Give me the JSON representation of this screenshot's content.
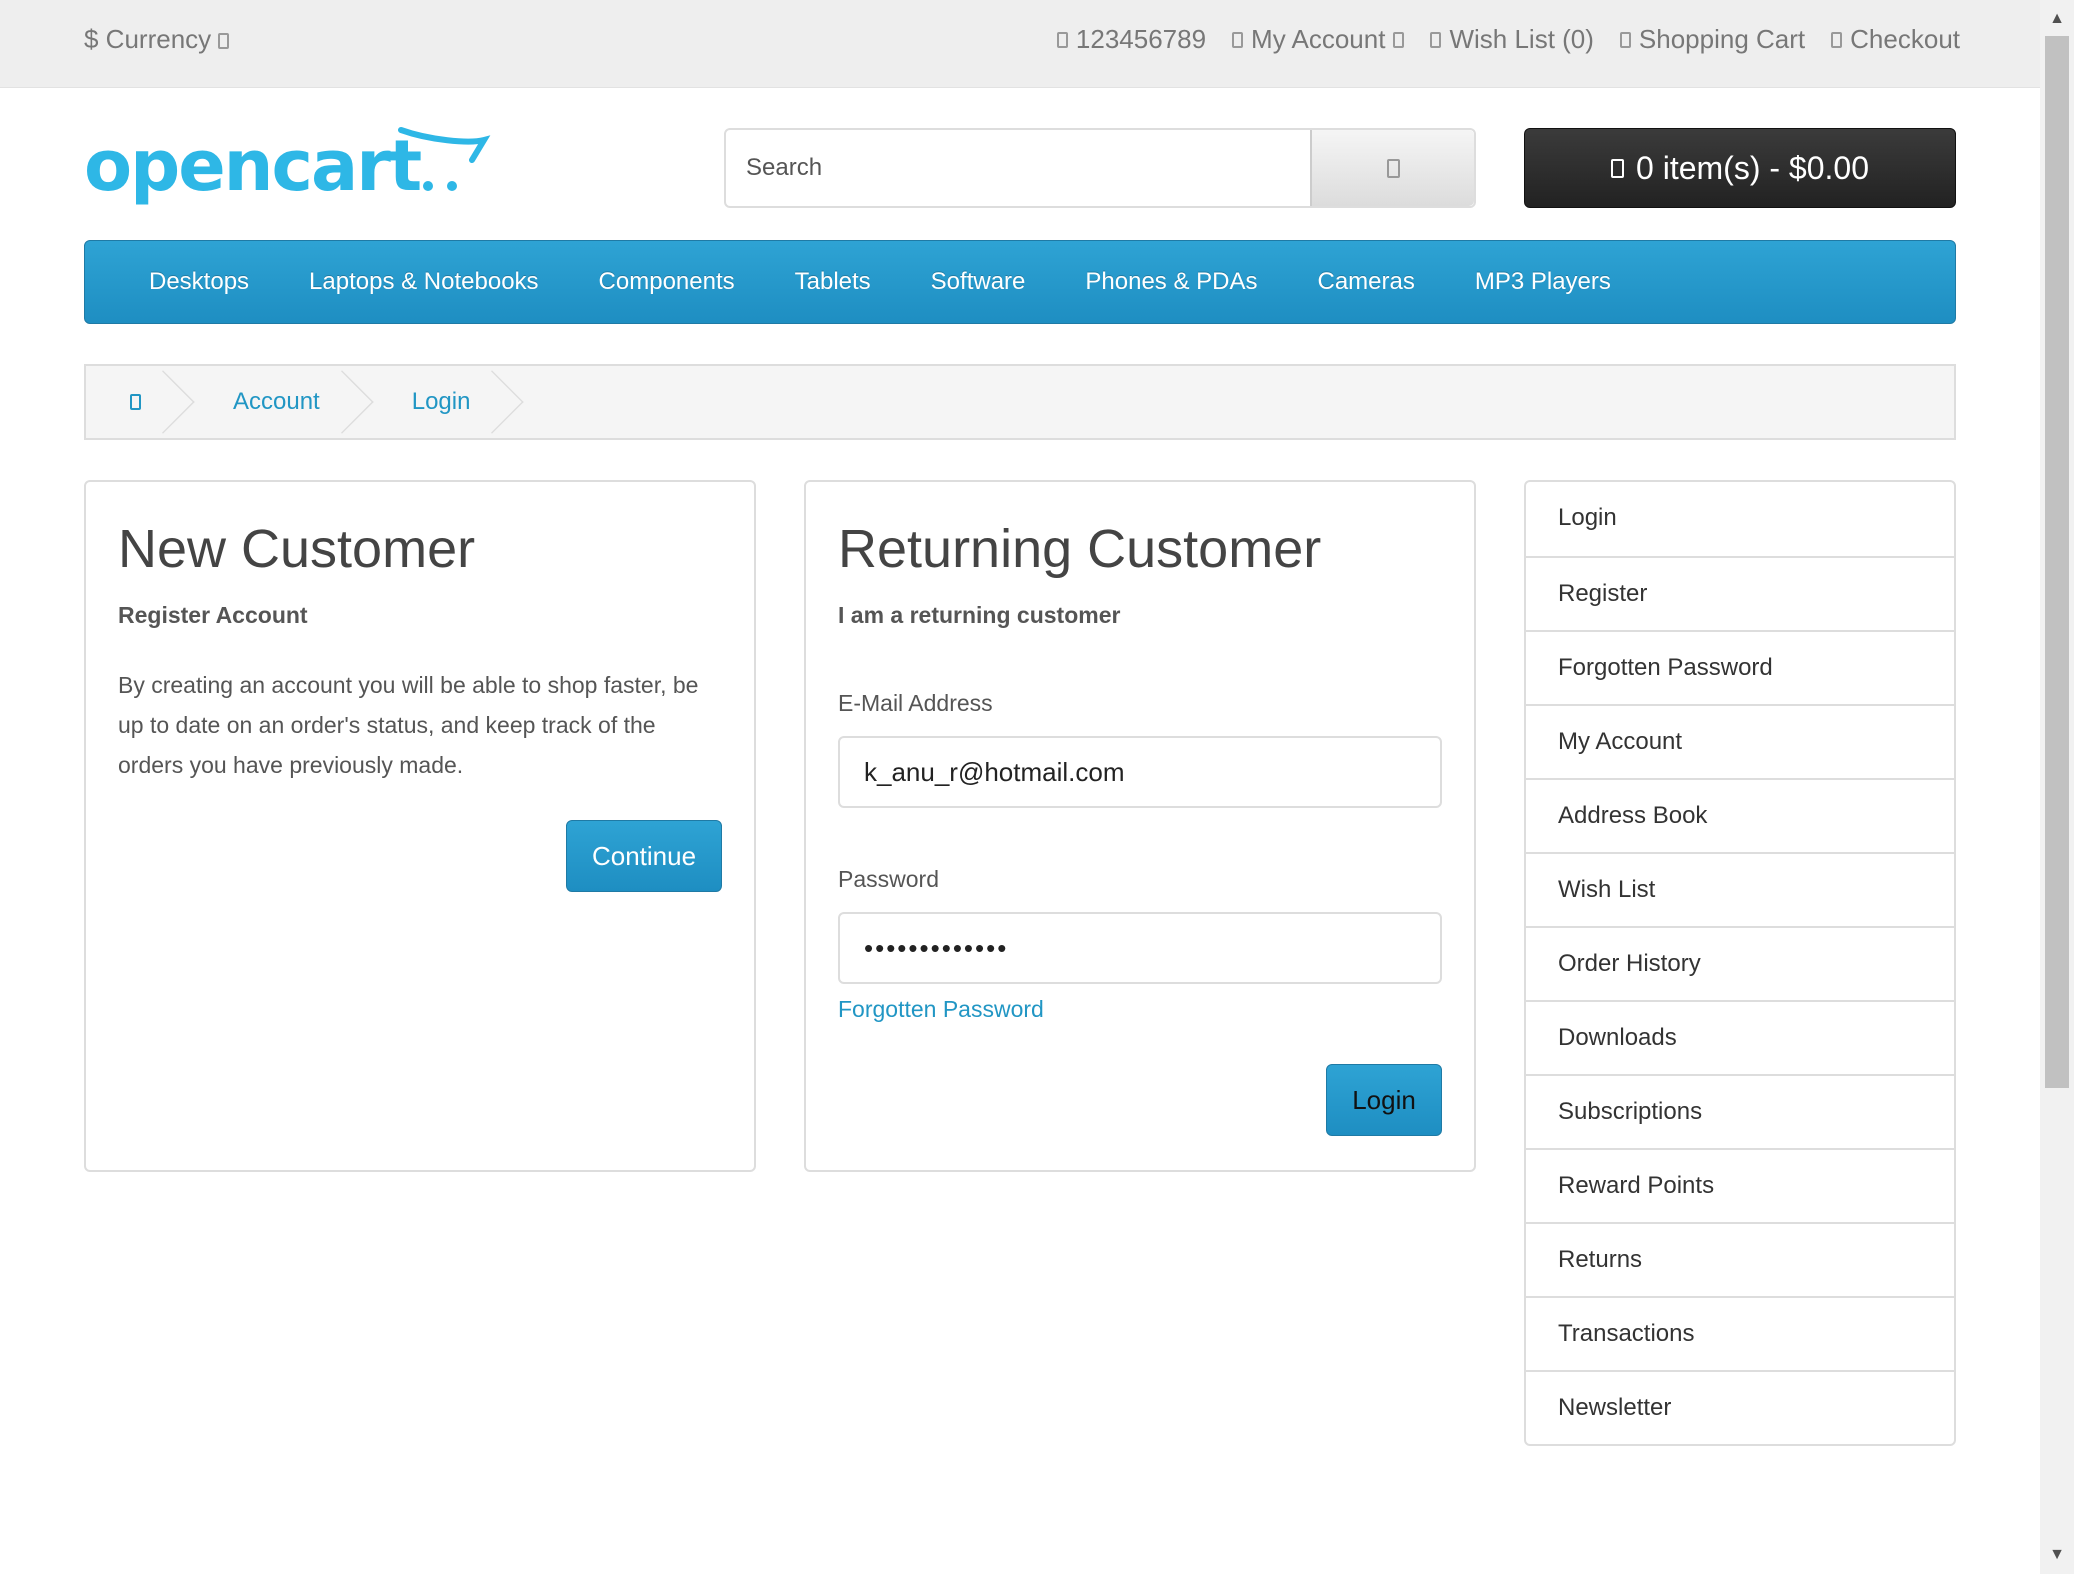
{
  "topbar": {
    "currency": "$ Currency",
    "phone": "123456789",
    "my_account": "My Account",
    "wish_list": "Wish List (0)",
    "shopping_cart": "Shopping Cart",
    "checkout": "Checkout"
  },
  "header": {
    "logo_text": "opencart",
    "search_placeholder": "Search",
    "cart_label": "0 item(s) - $0.00"
  },
  "nav": [
    "Desktops",
    "Laptops & Notebooks",
    "Components",
    "Tablets",
    "Software",
    "Phones & PDAs",
    "Cameras",
    "MP3 Players"
  ],
  "breadcrumb": [
    "Account",
    "Login"
  ],
  "new_customer": {
    "title": "New Customer",
    "subtitle": "Register Account",
    "description": "By creating an account you will be able to shop faster, be up to date on an order's status, and keep track of the orders you have previously made.",
    "button": "Continue"
  },
  "returning_customer": {
    "title": "Returning Customer",
    "subtitle": "I am a returning customer",
    "email_label": "E-Mail Address",
    "email_value": "k_anu_r@hotmail.com",
    "password_label": "Password",
    "password_value": "•••••••••••••",
    "forgot_link": "Forgotten Password",
    "button": "Login"
  },
  "sidebar": [
    "Login",
    "Register",
    "Forgotten Password",
    "My Account",
    "Address Book",
    "Wish List",
    "Order History",
    "Downloads",
    "Subscriptions",
    "Reward Points",
    "Returns",
    "Transactions",
    "Newsletter"
  ],
  "colors": {
    "accent": "#229ac8",
    "cart_bg": "#2a2a2a",
    "topbar_bg": "#eeeeee"
  },
  "icons": [
    "caret-down-icon",
    "phone-icon",
    "user-icon",
    "heart-icon",
    "cart-icon",
    "share-icon",
    "search-icon",
    "home-icon"
  ]
}
